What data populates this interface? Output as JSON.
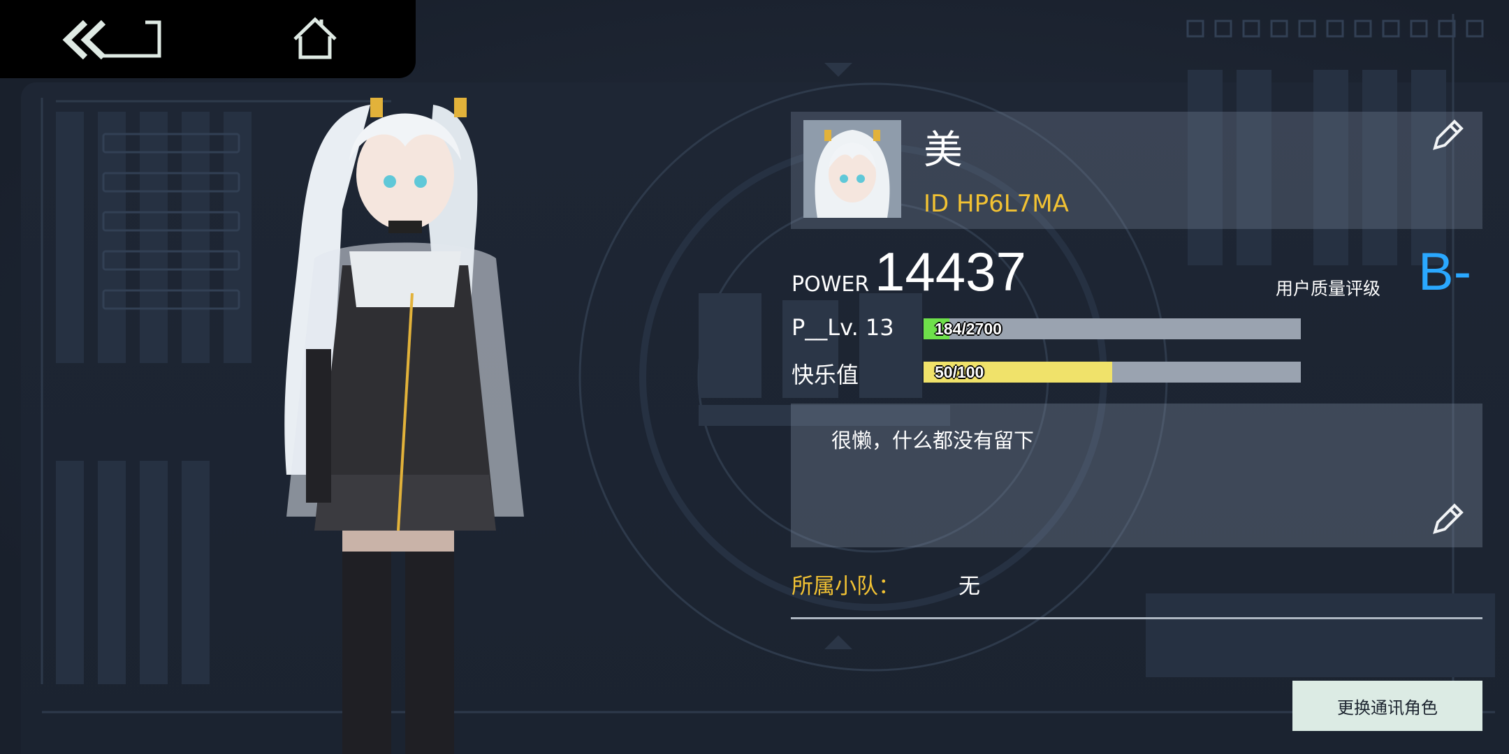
{
  "nav": {
    "back_icon": "double-chevron-left-icon",
    "home_icon": "home-icon"
  },
  "profile": {
    "name": "美",
    "id_text": "ID HP6L7MA",
    "edit_icon": "pencil-icon"
  },
  "stats": {
    "power_label": "POWER",
    "power_value": "14437",
    "rating_label": "用户质量评级",
    "rating_value": "B-",
    "level_label": "P__Lv. 13",
    "exp_text": "184/2700",
    "exp_fraction": 0.068,
    "happiness_label": "快乐值",
    "happiness_text": "50/100",
    "happiness_fraction": 0.5
  },
  "bio": {
    "text": "很懒，什么都没有留下"
  },
  "squad": {
    "label": "所属小队：",
    "value": "无"
  },
  "actions": {
    "switch_character_label": "更换通讯角色"
  },
  "colors": {
    "accent_yellow": "#f2c233",
    "accent_blue": "#2aa8ff",
    "exp_green": "#6ee04a",
    "happiness_yellow": "#f0e26a"
  }
}
